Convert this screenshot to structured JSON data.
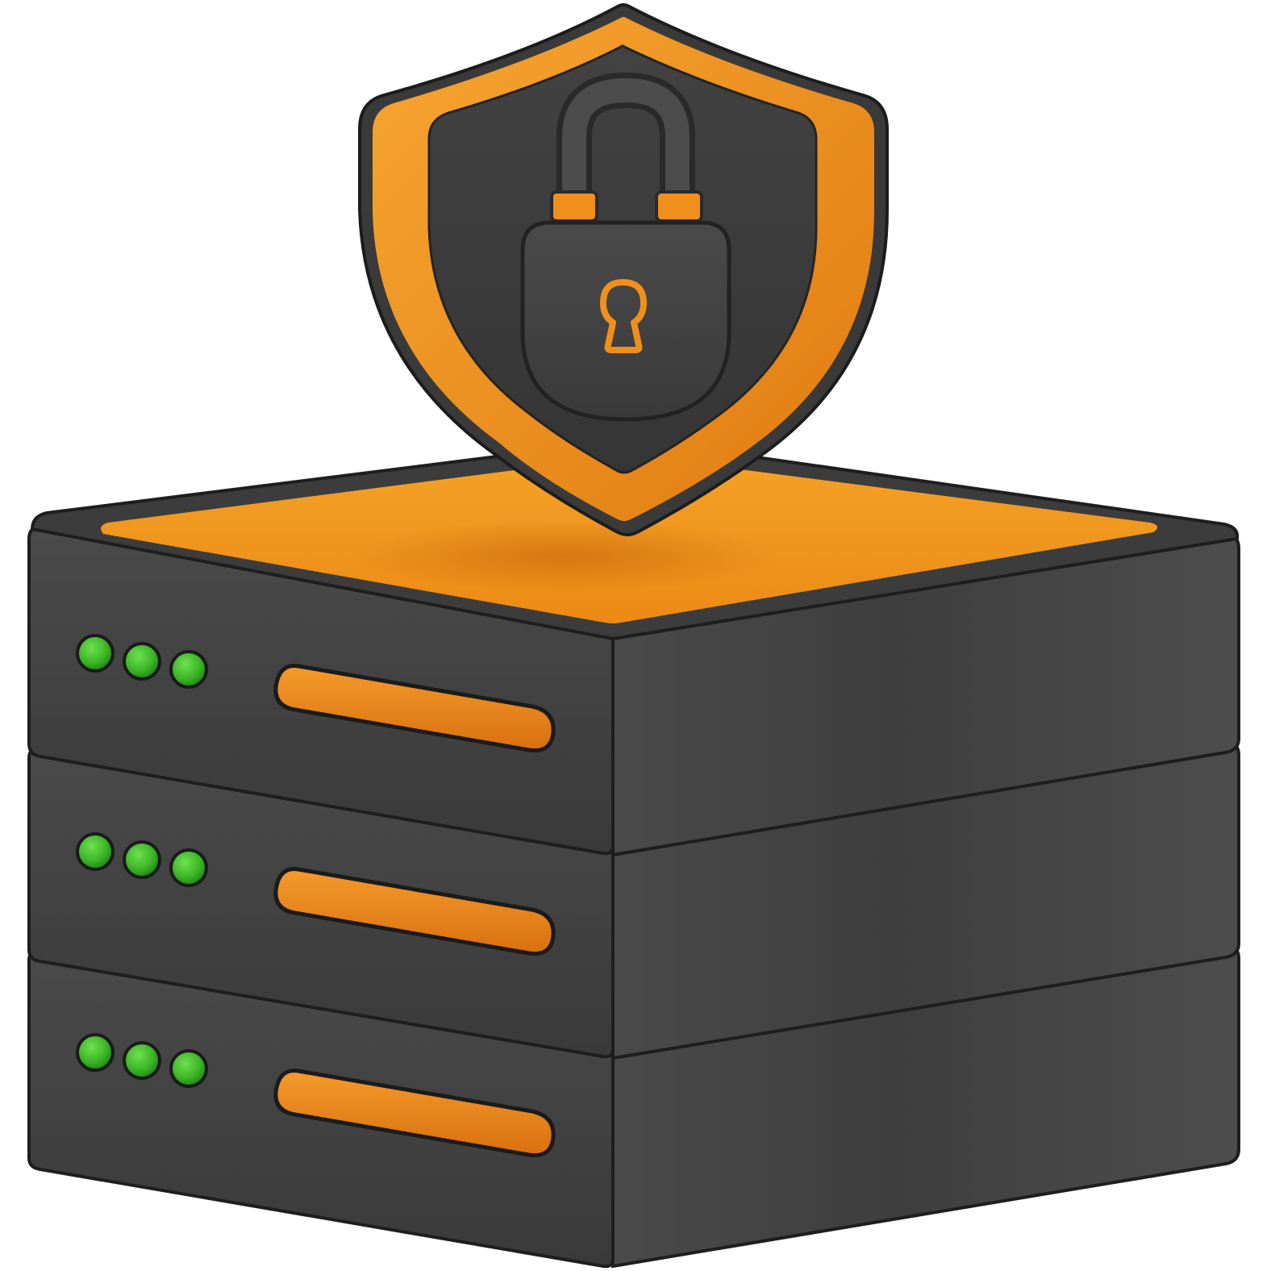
{
  "illustration": {
    "subject": "server-security",
    "icons": [
      "shield-icon",
      "padlock-icon",
      "keyhole-icon",
      "server-stack-icon",
      "status-led-icon",
      "drive-slot-icon"
    ],
    "server_units": [
      {
        "leds": 3,
        "led_state": "on"
      },
      {
        "leds": 3,
        "led_state": "on"
      },
      {
        "leds": 3,
        "led_state": "on"
      }
    ]
  },
  "colors": {
    "background": "#ffffff",
    "server_body": "#464646",
    "server_dark": "#2f2f2f",
    "server_shadow": "#1c1c1c",
    "accent_orange": "#f0901a",
    "accent_orange_dark": "#d9720f",
    "accent_orange_light": "#f5a834",
    "shield_dark": "#3b3b3b",
    "led_green": "#3fbf2a",
    "led_green_dark": "#1f7a16"
  }
}
